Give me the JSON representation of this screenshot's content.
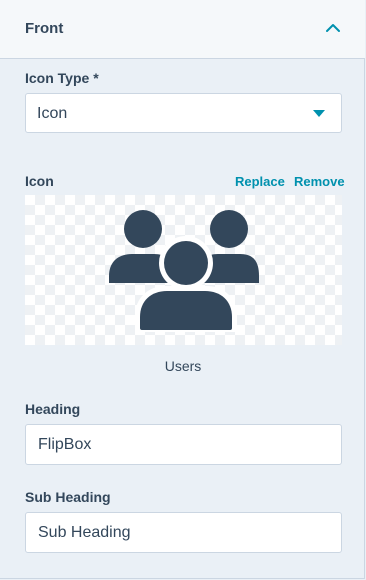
{
  "panel": {
    "title": "Front",
    "collapse_icon": "chevron-up-icon"
  },
  "icon_type": {
    "label": "Icon Type *",
    "selected": "Icon"
  },
  "icon": {
    "label": "Icon",
    "replace_label": "Replace",
    "remove_label": "Remove",
    "preview_icon": "users-icon",
    "name": "Users"
  },
  "heading": {
    "label": "Heading",
    "value": "FlipBox"
  },
  "sub_heading": {
    "label": "Sub Heading",
    "value": "Sub Heading"
  },
  "colors": {
    "accent": "#0091ae",
    "text": "#33475b",
    "panel_bg": "#eaf0f6",
    "icon_fill": "#33475b"
  }
}
